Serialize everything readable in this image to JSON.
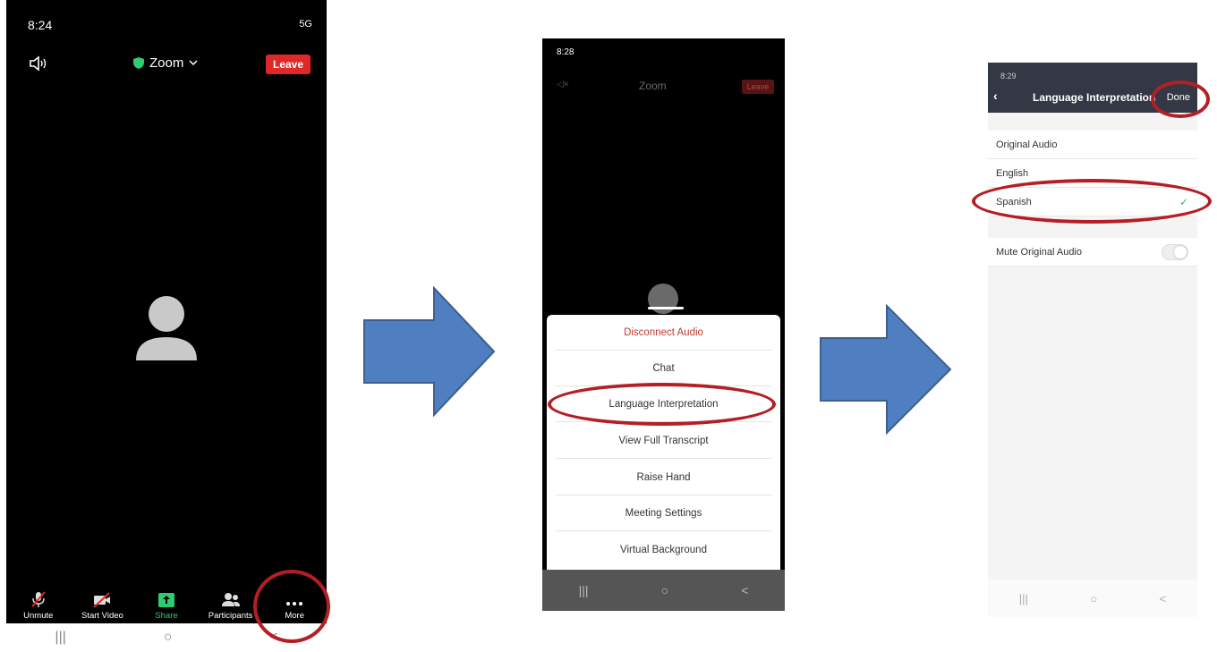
{
  "phone1": {
    "status_time": "8:24",
    "status_right": "5G",
    "title": "Zoom",
    "leave_label": "Leave",
    "toolbar": [
      {
        "id": "unmute",
        "label": "Unmute"
      },
      {
        "id": "start-video",
        "label": "Start Video"
      },
      {
        "id": "share",
        "label": "Share"
      },
      {
        "id": "participants",
        "label": "Participants"
      },
      {
        "id": "more",
        "label": "More"
      }
    ],
    "nav": [
      "|||",
      "○",
      "<"
    ]
  },
  "phone2": {
    "status_time": "8:28",
    "title": "Zoom",
    "leave_label": "Leave",
    "menu": [
      "Disconnect Audio",
      "Chat",
      "Language Interpretation",
      "View Full Transcript",
      "Raise Hand",
      "Meeting Settings",
      "Virtual Background"
    ],
    "nav": [
      "|||",
      "○",
      "<"
    ]
  },
  "phone3": {
    "status_time": "8:29",
    "title": "Language Interpretation",
    "done_label": "Done",
    "options": [
      "Original Audio",
      "English",
      "Spanish"
    ],
    "mute_label": "Mute Original Audio",
    "nav": [
      "|||",
      "○",
      "<"
    ]
  },
  "colors": {
    "arrow_fill": "#4f7fc0",
    "arrow_stroke": "#3b5f8f",
    "ring": "#b41f24",
    "leave_red": "#e02828",
    "check_green": "#3cb371"
  }
}
